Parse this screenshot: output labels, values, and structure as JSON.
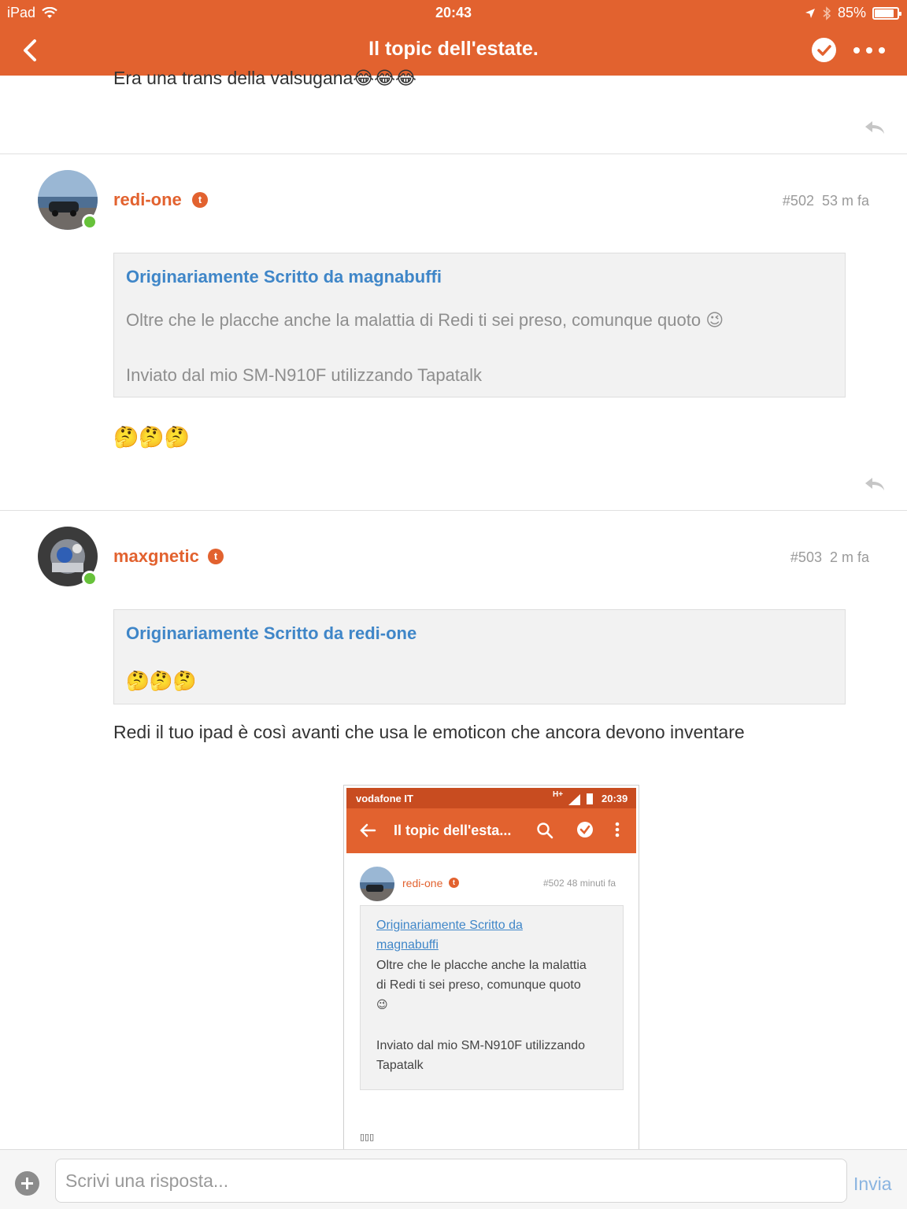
{
  "status_bar": {
    "device": "iPad",
    "time": "20:43",
    "battery": "85%",
    "battery_level": 0.85
  },
  "nav": {
    "title": "Il topic dell'estate."
  },
  "previous_post": {
    "text": "Era una trans della valsugana😂😂😂"
  },
  "posts": [
    {
      "username": "redi-one",
      "badge": "t",
      "number": "#502",
      "time": "53 m fa",
      "quote": {
        "header": "Originariamente Scritto da magnabuffi",
        "lines": [
          "Oltre che le placche anche la malattia di Redi ti sei preso, comunque quoto 😉",
          "Inviato dal mio SM-N910F utilizzando Tapatalk"
        ]
      },
      "body": "🤔🤔🤔"
    },
    {
      "username": "maxgnetic",
      "badge": "t",
      "number": "#503",
      "time": "2 m fa",
      "quote": {
        "header": "Originariamente Scritto da redi-one",
        "lines": [
          "🤔🤔🤔"
        ]
      },
      "body": "Redi il tuo ipad è così avanti che usa le emoticon che ancora devono inventare"
    }
  ],
  "embedded_screenshot": {
    "carrier": "vodafone IT",
    "network": "H+",
    "time": "20:39",
    "title": "Il topic dell'esta...",
    "username": "redi-one",
    "badge": "t",
    "number": "#502",
    "time_ago": "48 minuti fa",
    "quote_link_1": "Originariamente Scritto da",
    "quote_link_2": "magnabuffi",
    "quote_lines": [
      "Oltre che le placche anche la malattia",
      "di Redi ti sei preso, comunque quoto",
      "😉",
      "Inviato dal mio SM-N910F utilizzando",
      "Tapatalk"
    ],
    "tail": "▯▯▯"
  },
  "composer": {
    "placeholder": "Scrivi una risposta...",
    "send_label": "Invia"
  },
  "colors": {
    "accent": "#e2622f",
    "link": "#3f86c8",
    "online": "#67c23a",
    "send": "#8ab4e0"
  },
  "icons": [
    "back-arrow-icon",
    "check-circle-icon",
    "more-dots-icon",
    "reply-icon",
    "plus-icon",
    "wifi-icon",
    "location-arrow-icon",
    "bluetooth-icon",
    "battery-icon",
    "search-icon"
  ]
}
